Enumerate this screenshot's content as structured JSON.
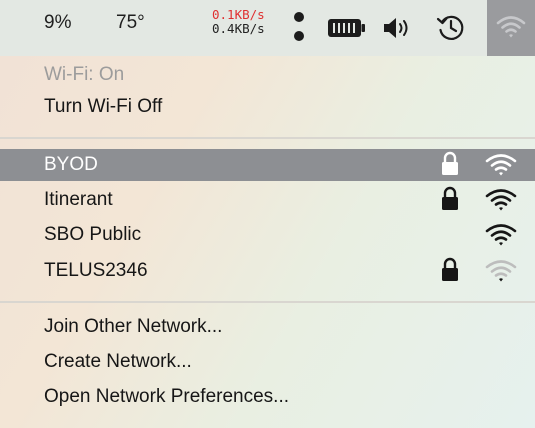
{
  "menubar": {
    "battery_percent": "9%",
    "temperature": "75°",
    "net_upload": "0.1KB/s",
    "net_download": "0.4KB/s",
    "icons": [
      "dots-icon",
      "battery-icon",
      "volume-icon",
      "time-machine-icon",
      "wifi-icon"
    ]
  },
  "wifi_menu": {
    "status": "Wi-Fi: On",
    "toggle_label": "Turn Wi-Fi Off",
    "networks": [
      {
        "name": "BYOD",
        "locked": true,
        "selected": true,
        "signal": 4
      },
      {
        "name": "Itinerant",
        "locked": true,
        "selected": false,
        "signal": 4
      },
      {
        "name": "SBO Public",
        "locked": false,
        "selected": false,
        "signal": 4
      },
      {
        "name": "TELUS2346",
        "locked": true,
        "selected": false,
        "signal": 1
      }
    ],
    "join_other": "Join Other Network...",
    "create_network": "Create Network...",
    "open_prefs": "Open Network Preferences..."
  },
  "colors": {
    "selection_bg": "#8d8f93",
    "upload_red": "#e03030",
    "menubar_bg": "#e3e8e3"
  }
}
